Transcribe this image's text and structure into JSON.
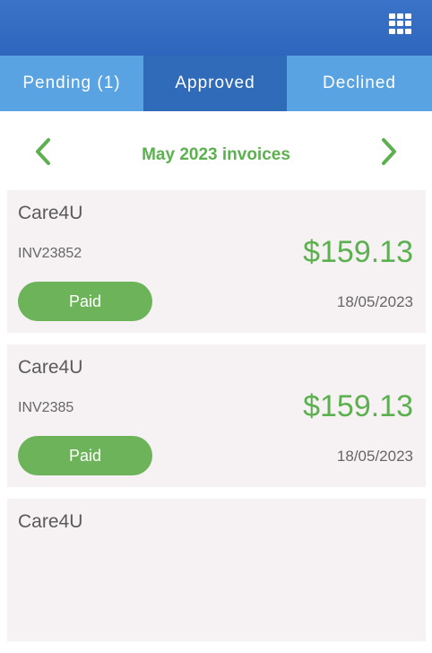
{
  "colors": {
    "header": "#2f66bd",
    "tab_bar": "#5aa3e3",
    "tab_active": "#2f6bb8",
    "accent_green": "#5cb04f",
    "card_bg": "#f6f2f3"
  },
  "header": {
    "menu_icon": "grid-icon"
  },
  "tabs": [
    {
      "label": "Pending (1)",
      "active": false
    },
    {
      "label": "Approved",
      "active": true
    },
    {
      "label": "Declined",
      "active": false
    }
  ],
  "month_nav": {
    "title": "May 2023 invoices",
    "prev_icon": "chevron-left-icon",
    "next_icon": "chevron-right-icon"
  },
  "invoices": [
    {
      "vendor": "Care4U",
      "invoice_no": "INV23852",
      "amount": "$159.13",
      "status": "Paid",
      "date": "18/05/2023"
    },
    {
      "vendor": "Care4U",
      "invoice_no": "INV2385",
      "amount": "$159.13",
      "status": "Paid",
      "date": "18/05/2023"
    },
    {
      "vendor": "Care4U"
    }
  ]
}
